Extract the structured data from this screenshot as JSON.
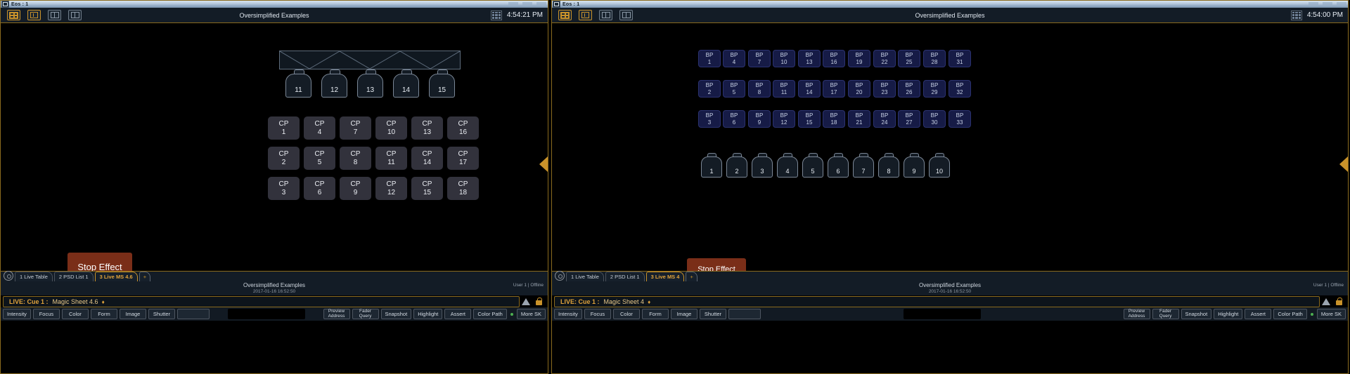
{
  "app": {
    "name": "Eos : 1",
    "title": "Oversimplified Examples"
  },
  "left": {
    "clock": "4:54:21 PM",
    "truss_fixtures": [
      {
        "label": "11"
      },
      {
        "label": "12"
      },
      {
        "label": "13"
      },
      {
        "label": "14"
      },
      {
        "label": "15"
      }
    ],
    "color_palettes": [
      {
        "kind": "CP",
        "num": "1"
      },
      {
        "kind": "CP",
        "num": "4"
      },
      {
        "kind": "CP",
        "num": "7"
      },
      {
        "kind": "CP",
        "num": "10"
      },
      {
        "kind": "CP",
        "num": "13"
      },
      {
        "kind": "CP",
        "num": "16"
      },
      {
        "kind": "CP",
        "num": "2"
      },
      {
        "kind": "CP",
        "num": "5"
      },
      {
        "kind": "CP",
        "num": "8"
      },
      {
        "kind": "CP",
        "num": "11"
      },
      {
        "kind": "CP",
        "num": "14"
      },
      {
        "kind": "CP",
        "num": "17"
      },
      {
        "kind": "CP",
        "num": "3"
      },
      {
        "kind": "CP",
        "num": "6"
      },
      {
        "kind": "CP",
        "num": "9"
      },
      {
        "kind": "CP",
        "num": "12"
      },
      {
        "kind": "CP",
        "num": "15"
      },
      {
        "kind": "CP",
        "num": "18"
      }
    ],
    "stop_effect_label": "Stop Effect",
    "tabs": [
      {
        "label": "1 Live Table",
        "active": false
      },
      {
        "label": "2 PSD List 1",
        "active": false
      },
      {
        "label": "3 Live MS 4.6",
        "active": true
      },
      {
        "label": "+",
        "active": false
      }
    ],
    "magic_sheet": {
      "title": "Oversimplified Examples",
      "date": "2017-01-16 16:52:50"
    },
    "user_status": "User 1 | Offline",
    "cue": {
      "live": "LIVE: Cue  1 :",
      "name": "Magic Sheet 4.6",
      "diamond": "♦"
    },
    "toolbar_left": [
      "Intensity",
      "Focus",
      "Color",
      "Form",
      "Image",
      "Shutter",
      ""
    ],
    "toolbar_right": [
      "Preview\nAddress",
      "Fader\nQuery",
      "Snapshot",
      "Highlight",
      "Assert",
      "Color Path",
      "More SK"
    ]
  },
  "right": {
    "clock": "4:54:00 PM",
    "beam_palettes": [
      {
        "kind": "BP",
        "num": "1"
      },
      {
        "kind": "BP",
        "num": "4"
      },
      {
        "kind": "BP",
        "num": "7"
      },
      {
        "kind": "BP",
        "num": "10"
      },
      {
        "kind": "BP",
        "num": "13"
      },
      {
        "kind": "BP",
        "num": "16"
      },
      {
        "kind": "BP",
        "num": "19"
      },
      {
        "kind": "BP",
        "num": "22"
      },
      {
        "kind": "BP",
        "num": "25"
      },
      {
        "kind": "BP",
        "num": "28"
      },
      {
        "kind": "BP",
        "num": "31"
      },
      {
        "kind": "BP",
        "num": "2"
      },
      {
        "kind": "BP",
        "num": "5"
      },
      {
        "kind": "BP",
        "num": "8"
      },
      {
        "kind": "BP",
        "num": "11"
      },
      {
        "kind": "BP",
        "num": "14"
      },
      {
        "kind": "BP",
        "num": "17"
      },
      {
        "kind": "BP",
        "num": "20"
      },
      {
        "kind": "BP",
        "num": "23"
      },
      {
        "kind": "BP",
        "num": "26"
      },
      {
        "kind": "BP",
        "num": "29"
      },
      {
        "kind": "BP",
        "num": "32"
      },
      {
        "kind": "BP",
        "num": "3"
      },
      {
        "kind": "BP",
        "num": "6"
      },
      {
        "kind": "BP",
        "num": "9"
      },
      {
        "kind": "BP",
        "num": "12"
      },
      {
        "kind": "BP",
        "num": "15"
      },
      {
        "kind": "BP",
        "num": "18"
      },
      {
        "kind": "BP",
        "num": "21"
      },
      {
        "kind": "BP",
        "num": "24"
      },
      {
        "kind": "BP",
        "num": "27"
      },
      {
        "kind": "BP",
        "num": "30"
      },
      {
        "kind": "BP",
        "num": "33"
      }
    ],
    "fixtures": [
      {
        "label": "1"
      },
      {
        "label": "2"
      },
      {
        "label": "3"
      },
      {
        "label": "4"
      },
      {
        "label": "5"
      },
      {
        "label": "6"
      },
      {
        "label": "7"
      },
      {
        "label": "8"
      },
      {
        "label": "9"
      },
      {
        "label": "10"
      }
    ],
    "stop_effect_label": "Stop Effect",
    "tabs": [
      {
        "label": "1 Live Table",
        "active": false
      },
      {
        "label": "2 PSD List 1",
        "active": false
      },
      {
        "label": "3 Live MS 4",
        "active": true
      },
      {
        "label": "+",
        "active": false
      }
    ],
    "magic_sheet": {
      "title": "Oversimplified Examples",
      "date": "2017-01-16 16:52:50"
    },
    "user_status": "User 1 | Offline",
    "cue": {
      "live": "LIVE: Cue  1 :",
      "name": "Magic Sheet 4",
      "diamond": "♦"
    },
    "toolbar_left": [
      "Intensity",
      "Focus",
      "Color",
      "Form",
      "Image",
      "Shutter",
      ""
    ],
    "toolbar_right": [
      "Preview\nAddress",
      "Fader\nQuery",
      "Snapshot",
      "Highlight",
      "Assert",
      "Color Path",
      "More SK"
    ]
  },
  "colors": {
    "accent": "#c9922a",
    "stop_effect_bg": "#7a2e18",
    "cp_bg": "#32323c",
    "bp_bg": "#161b46",
    "panel_bg": "#131c26"
  }
}
